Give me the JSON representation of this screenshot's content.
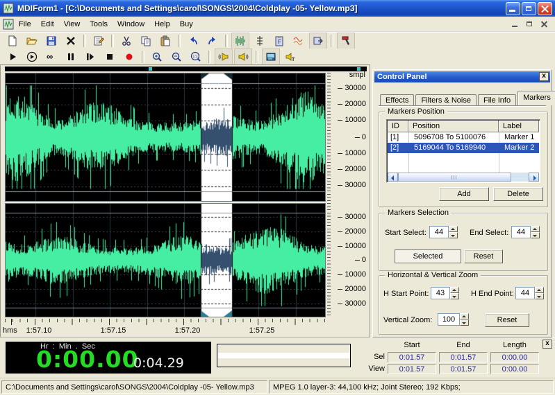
{
  "window": {
    "title": "MDIForm1 - [C:\\Documents and Settings\\carol\\SONGS\\2004\\Coldplay -05- Yellow.mp3]"
  },
  "menu": {
    "items": [
      "File",
      "Edit",
      "View",
      "Tools",
      "Window",
      "Help",
      "Buy"
    ]
  },
  "toolbar_main": {
    "items": [
      {
        "type": "button",
        "name": "new-file"
      },
      {
        "type": "button",
        "name": "open-file"
      },
      {
        "type": "button",
        "name": "save-file"
      },
      {
        "type": "button",
        "name": "delete-file"
      },
      {
        "type": "separator"
      },
      {
        "type": "button",
        "name": "properties"
      },
      {
        "type": "separator"
      },
      {
        "type": "button",
        "name": "cut"
      },
      {
        "type": "button",
        "name": "copy"
      },
      {
        "type": "button",
        "name": "paste"
      },
      {
        "type": "separator"
      },
      {
        "type": "button",
        "name": "undo"
      },
      {
        "type": "button",
        "name": "redo"
      },
      {
        "type": "separator"
      },
      {
        "type": "button",
        "name": "waveform-view",
        "highlight": true
      },
      {
        "type": "button",
        "name": "marker-tool"
      },
      {
        "type": "button",
        "name": "paste-special"
      },
      {
        "type": "button",
        "name": "effects-wave"
      },
      {
        "type": "button",
        "name": "export-audio",
        "highlight": true
      },
      {
        "type": "separator"
      },
      {
        "type": "button",
        "name": "tools",
        "highlight": true
      }
    ]
  },
  "toolbar_transport": {
    "items": [
      {
        "type": "button",
        "name": "play"
      },
      {
        "type": "button",
        "name": "play-all"
      },
      {
        "type": "button",
        "name": "loop-infinite"
      },
      {
        "type": "button",
        "name": "pause"
      },
      {
        "type": "button",
        "name": "step-forward"
      },
      {
        "type": "button",
        "name": "stop"
      },
      {
        "type": "button",
        "name": "record"
      },
      {
        "type": "separator"
      },
      {
        "type": "button",
        "name": "zoom-in"
      },
      {
        "type": "button",
        "name": "zoom-out"
      },
      {
        "type": "button",
        "name": "zoom-actual"
      },
      {
        "type": "separator"
      },
      {
        "type": "button",
        "name": "speaker-left",
        "highlight": true
      },
      {
        "type": "button",
        "name": "speaker-right",
        "highlight": true
      },
      {
        "type": "separator"
      },
      {
        "type": "button",
        "name": "display-info",
        "highlight": true
      },
      {
        "type": "button",
        "name": "speaker-text"
      }
    ]
  },
  "waveform": {
    "unit_label": "smpl",
    "amplitude_ticks": [
      "30000",
      "20000",
      "10000",
      "0",
      "10000",
      "20000",
      "30000"
    ],
    "time_axis_label": "hms",
    "time_ticks": [
      "1:57.10",
      "1:57.15",
      "1:57.20",
      "1:57.25"
    ],
    "selection": {
      "start_frac": 0.611,
      "end_frac": 0.709
    },
    "colors": {
      "background": "#000000",
      "wave": "#45eea2",
      "selection_bg": "#ffffff",
      "selection_wave": "#34506e",
      "zero_line": "#7a2e2e",
      "grid": "#2a363e",
      "level_dash": "#38444c",
      "frame_line": "#8c98a4",
      "handle_bottom": "#2f7d8e",
      "handle_top": "#142830",
      "overview_marker": "#30c8c8"
    }
  },
  "control_panel": {
    "title": "Control Panel",
    "tabs": [
      {
        "label": "Effects",
        "active": false
      },
      {
        "label": "Filters & Noise",
        "active": false
      },
      {
        "label": "File Info",
        "active": false
      },
      {
        "label": "Markers",
        "active": true
      }
    ],
    "markers_position": {
      "group_label": "Markers Position",
      "columns": [
        "ID",
        "Position",
        "Label"
      ],
      "rows": [
        {
          "id": "[1]",
          "position": "5096708 To 5100076",
          "label": "Marker 1",
          "selected": false
        },
        {
          "id": "[2]",
          "position": "5169044 To 5169940",
          "label": "Marker 2",
          "selected": true
        }
      ],
      "add_label": "Add",
      "delete_label": "Delete"
    },
    "markers_selection": {
      "group_label": "Markers Selection",
      "start_label": "Start Select:",
      "start_value": "44",
      "end_label": "End Select:",
      "end_value": "44",
      "selected_label": "Selected",
      "reset_label": "Reset"
    },
    "zoom_group": {
      "group_label": "Horizontal & Vertical Zoom",
      "h_start_label": "H Start Point:",
      "h_start_value": "43",
      "h_end_label": "H End Point:",
      "h_end_value": "44",
      "vertical_label": "Vertical Zoom:",
      "vertical_value": "100",
      "reset_label": "Reset"
    }
  },
  "time_panel": {
    "units_label": "Hr  :  Min  .  Sec",
    "elapsed": "0:00.00",
    "total": "0:04.29",
    "elapsed_color": "#23DC23"
  },
  "selection_info": {
    "columns": [
      "Start",
      "End",
      "Length"
    ],
    "rows": [
      {
        "name": "Sel",
        "values": [
          "0:01.57",
          "0:01.57",
          "0:00.00"
        ]
      },
      {
        "name": "View",
        "values": [
          "0:01.57",
          "0:01.57",
          "0:00.00"
        ]
      }
    ]
  },
  "status_bar": {
    "file_path": "C:\\Documents and Settings\\carol\\SONGS\\2004\\Coldplay -05- Yellow.mp3",
    "format_info": "MPEG 1.0 layer-3: 44,100 kHz; Joint Stereo; 192 Kbps;"
  }
}
